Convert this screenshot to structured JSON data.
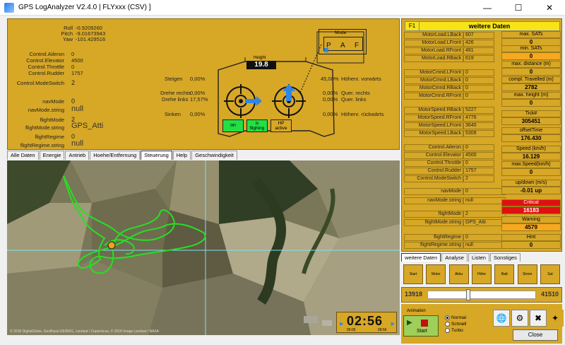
{
  "window": {
    "title": "GPS LogAnalyzer V2.4.0  | FLYxxx (CSV) ]",
    "minimize": "—",
    "maximize": "☐",
    "close": "✕"
  },
  "attitude": {
    "roll_label": "Roll",
    "roll_value": "-0.9209260",
    "pitch_label": "Pitch",
    "pitch_value": "-9.01673943",
    "yaw_label": "Yaw",
    "yaw_value": "-101.429516"
  },
  "controls": {
    "aileron_label": "Control.Aileron",
    "aileron_value": "0",
    "elevator_label": "Control.Elevator",
    "elevator_value": "4500",
    "throttle_label": "Control.Throttle",
    "throttle_value": "0",
    "rudder_label": "Control.Rudder",
    "rudder_value": "1757",
    "modeswitch_label": "Control.ModeSwitch",
    "modeswitch_value": "2"
  },
  "modes": {
    "navmode_label": "navMode",
    "navmode_value": "0",
    "navmode_str_label": "navMode.string",
    "navmode_str_value": "null",
    "flightmode_label": "flightMode",
    "flightmode_value": "2",
    "flightmode_str_label": "flightMode.string",
    "flightmode_str_value": "GPS_Atti",
    "flightregime_label": "flightRegime",
    "flightregime_value": "0",
    "flightregime_str_label": "flightRegime.string",
    "flightregime_str_value": "null"
  },
  "rc": {
    "steigen_label": "Steigen",
    "steigen_value": "0,00%",
    "drehe_rechts_label": "Drehe rechts",
    "drehe_rechts_value": "0,00%",
    "drehe_links_label": "Drehe links",
    "drehe_links_value": "17,57%",
    "sinken_label": "Sinken",
    "sinken_value": "0,00%",
    "hoehe_vor_value": "45,00%",
    "hoehe_vor_label": "Höhenr. vorwärts",
    "quer_rechts_value": "0,00%",
    "quer_rechts_label": "Quer. rechts",
    "quer_links_value": "0,00%",
    "quer_links_label": "Quer. links",
    "hoehe_rueck_value": "0,00%",
    "hoehe_rueck_label": "Höhenr. rückwärts",
    "mode_label": "Mode",
    "mode_p": "P",
    "mode_a": "A",
    "mode_f": "F",
    "height_label": "Height",
    "height_value": "19.8",
    "btn_on": "on",
    "btn_isflighing": "is\nflighing",
    "btn_hp": "HP\nactive"
  },
  "tabs": [
    "Alle Daten",
    "Energie",
    "Antrieb",
    "Hoehe/Entfernung",
    "Steuerung",
    "Help",
    "Geschwindigkeit"
  ],
  "map": {
    "copyright": "© 2018 DigitalGlobe, GeoBasis-DE/BKG, Landsat / Copernicus, © 2018 Image Landsat / NASA",
    "clock_value": "02:56",
    "clock_left": "05:05",
    "clock_right": "09:56"
  },
  "right": {
    "f1": "F1",
    "header": "weitere Daten",
    "motor_load": [
      {
        "k": "MotorLoad.LBack",
        "v": "607"
      },
      {
        "k": "MotorLoad.LFront",
        "v": "426"
      },
      {
        "k": "MotorLoad.RFront",
        "v": "481"
      },
      {
        "k": "MotorLoad.RBack",
        "v": "619"
      }
    ],
    "motor_cmnd": [
      {
        "k": "MotorCmnd.LFront",
        "v": "0"
      },
      {
        "k": "MotorCmnd.LBack",
        "v": "0"
      },
      {
        "k": "MotorCmnd.RBack",
        "v": "0"
      },
      {
        "k": "MotorCmnd.RFront",
        "v": "0"
      }
    ],
    "motor_speed": [
      {
        "k": "MotorSpeed.RBack",
        "v": "5227"
      },
      {
        "k": "MotorSpeed.RFront",
        "v": "4776"
      },
      {
        "k": "MotorSpeed.LFront",
        "v": "3640"
      },
      {
        "k": "MotorSpeed.LBack",
        "v": "5309"
      }
    ],
    "control": [
      {
        "k": "Control.Aileron",
        "v": "0"
      },
      {
        "k": "Control.Elevator",
        "v": "4500"
      },
      {
        "k": "Control.Throttle",
        "v": "0"
      },
      {
        "k": "Control.Rudder",
        "v": "1757"
      },
      {
        "k": "Control.ModeSwitch",
        "v": "2"
      }
    ],
    "nav": [
      {
        "k": "navMode",
        "v": "0"
      },
      {
        "k": "navMode.string",
        "v": "null"
      }
    ],
    "flight": [
      {
        "k": "flightMode",
        "v": "2"
      },
      {
        "k": "flightMode.string",
        "v": "GPS_Atti"
      }
    ],
    "regime": [
      {
        "k": "flightRegime",
        "v": "0"
      },
      {
        "k": "flightRegime.string",
        "v": "null"
      }
    ],
    "stats": {
      "max_sats_label": "max. SATs",
      "max_sats_value": "0",
      "min_sats_label": "min. SATs",
      "min_sats_value": "0",
      "max_dist_label": "max. distance (m)",
      "max_dist_value": "0",
      "compl_label": "compl. Travelled (m)",
      "compl_value": "2782",
      "max_height_label": "max. height (m)",
      "max_height_value": "0",
      "tick_label": "Tick#",
      "tick_value": "305451",
      "offset_label": "offsetTime",
      "offset_value": "176.430",
      "speed_label": "Speed (km/h)",
      "speed_value": "16.129",
      "max_speed_label": "max.Speed(km/h)",
      "max_speed_value": "0",
      "updown_label": "up/down (m/s)",
      "updown_value": "-0.01 up",
      "critical_label": "Critical",
      "critical_value": "16183",
      "warning_label": "Warning",
      "warning_value": "4579",
      "hint_label": "Hint",
      "hint_value": "0"
    },
    "tabs": [
      "weitere Daten",
      "Analyse",
      "Listen",
      "Sonstiges"
    ],
    "icon_labels": [
      "Start",
      "Motor",
      "Akku",
      "Höhe",
      "Batt",
      "Strom",
      "Sat"
    ],
    "slider_left": "13918",
    "slider_right": "41510",
    "slider_position": 0.37,
    "anim_label": "Animation",
    "anim_start": "Start",
    "radio_normal": "Normal",
    "radio_schnell": "Schnell",
    "radio_turbo": "Turbo",
    "close_label": "Close"
  }
}
